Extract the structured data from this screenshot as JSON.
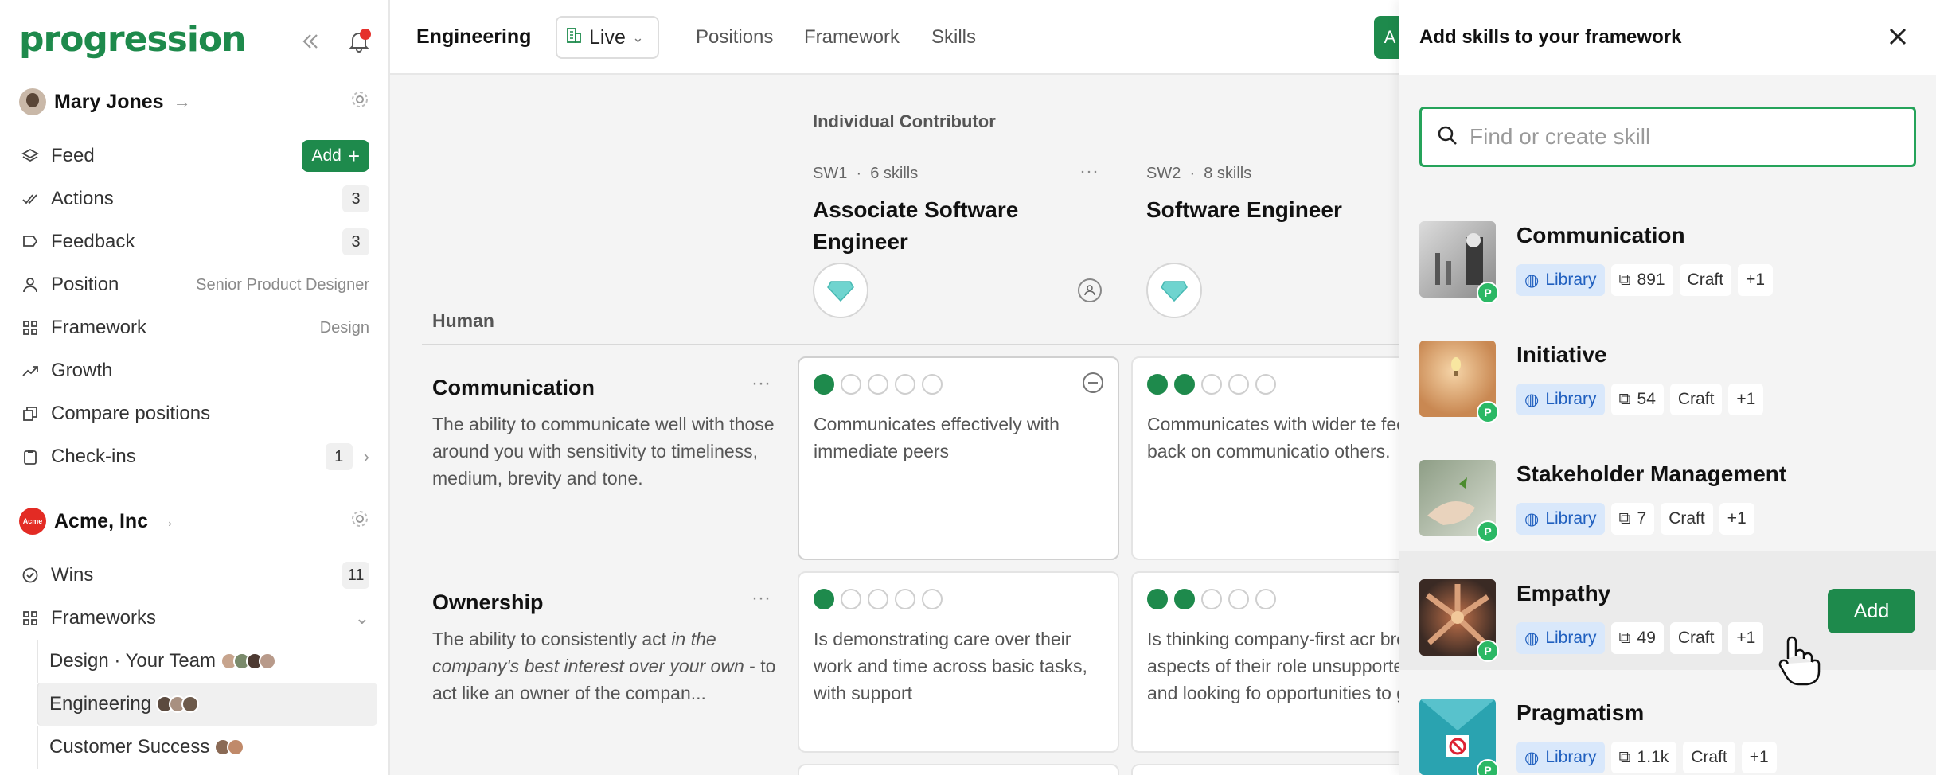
{
  "app": {
    "logo_text": "progression"
  },
  "sidebar": {
    "user": {
      "name": "Mary Jones"
    },
    "items": [
      {
        "label": "Feed",
        "action": "Add"
      },
      {
        "label": "Actions",
        "count": "3"
      },
      {
        "label": "Feedback",
        "count": "3"
      },
      {
        "label": "Position",
        "meta": "Senior Product Designer"
      },
      {
        "label": "Framework",
        "meta": "Design"
      },
      {
        "label": "Growth"
      },
      {
        "label": "Compare positions"
      },
      {
        "label": "Check-ins",
        "count": "1"
      }
    ],
    "org": {
      "name": "Acme, Inc",
      "logo_text": "Acme"
    },
    "org_items": [
      {
        "label": "Wins",
        "count": "11"
      },
      {
        "label": "Frameworks"
      }
    ],
    "frameworks": [
      {
        "label": "Design · Your Team"
      },
      {
        "label": "Engineering"
      },
      {
        "label": "Customer Success"
      }
    ]
  },
  "topbar": {
    "breadcrumb": "Engineering",
    "status": "Live",
    "nav": [
      "Positions",
      "Framework",
      "Skills"
    ],
    "cta_partial": "A"
  },
  "framework": {
    "track_title": "Individual Contributor",
    "positions": [
      {
        "code": "SW1",
        "skills": "6 skills",
        "title": "Associate Software Engineer"
      },
      {
        "code": "SW2",
        "skills": "8 skills",
        "title": "Software Engineer"
      }
    ],
    "category": "Human",
    "skills": [
      {
        "name": "Communication",
        "description": "The ability to communicate well with those around you with sensitivity to timeliness, medium, brevity and tone.",
        "levels": [
          {
            "filled": 1,
            "text": "Communicates effectively with immediate peers"
          },
          {
            "filled": 2,
            "text": "Communicates with wider te feeds back on communicatio others."
          }
        ]
      },
      {
        "name": "Ownership",
        "description_pre": "The ability to consistently act ",
        "description_em": "in the company's best interest over your own",
        "description_post": " - to act like an owner of the compan...",
        "levels": [
          {
            "filled": 1,
            "text": "Is demonstrating care over their work and time across basic tasks, with support"
          },
          {
            "filled": 2,
            "text": "Is thinking company-first acr broad aspects of their role unsupported, and looking fo opportunities to grow"
          }
        ]
      }
    ]
  },
  "panel": {
    "title": "Add skills to your framework",
    "search_placeholder": "Find or create skill",
    "library_label": "Library",
    "craft_label": "Craft",
    "extra_label": "+1",
    "badge": "P",
    "add_label": "Add",
    "items": [
      {
        "name": "Communication",
        "count": "891"
      },
      {
        "name": "Initiative",
        "count": "54"
      },
      {
        "name": "Stakeholder Management",
        "count": "7"
      },
      {
        "name": "Empathy",
        "count": "49"
      },
      {
        "name": "Pragmatism",
        "count": "1.1k"
      }
    ]
  },
  "colors": {
    "brand": "#1e8a4c",
    "library_tag_bg": "#d9e8fb",
    "badge": "#2bb865",
    "notification": "#e5322d"
  }
}
